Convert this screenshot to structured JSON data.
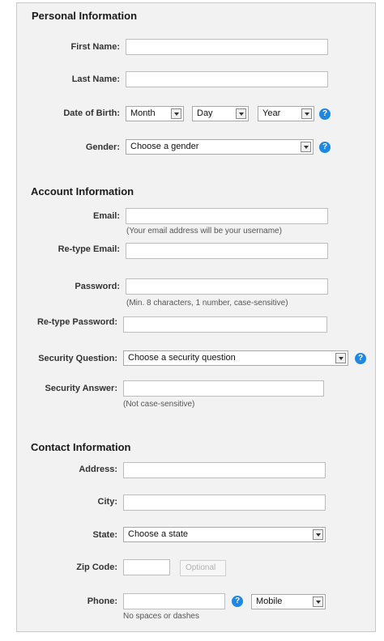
{
  "personal": {
    "title": "Personal Information",
    "first_name_label": "First Name:",
    "last_name_label": "Last Name:",
    "dob_label": "Date of Birth:",
    "dob_month": "Month",
    "dob_day": "Day",
    "dob_year": "Year",
    "gender_label": "Gender:",
    "gender_value": "Choose a gender",
    "help_glyph": "?"
  },
  "account": {
    "title": "Account Information",
    "email_label": "Email:",
    "email_hint": "(Your email address will be your username)",
    "retype_email_label": "Re-type Email:",
    "password_label": "Password:",
    "password_hint": "(Min. 8 characters, 1 number, case-sensitive)",
    "retype_password_label": "Re-type Password:",
    "security_question_label": "Security Question:",
    "security_question_value": "Choose a security question",
    "security_answer_label": "Security Answer:",
    "security_answer_hint": "(Not case-sensitive)"
  },
  "contact": {
    "title": "Contact Information",
    "address_label": "Address:",
    "city_label": "City:",
    "state_label": "State:",
    "state_value": "Choose a state",
    "zip_label": "Zip Code:",
    "optional_label": "Optional",
    "phone_label": "Phone:",
    "phone_type_value": "Mobile",
    "phone_hint": "No spaces or dashes"
  },
  "colors": {
    "panel_bg": "#f2f2f2",
    "help_blue": "#1e88e5"
  }
}
